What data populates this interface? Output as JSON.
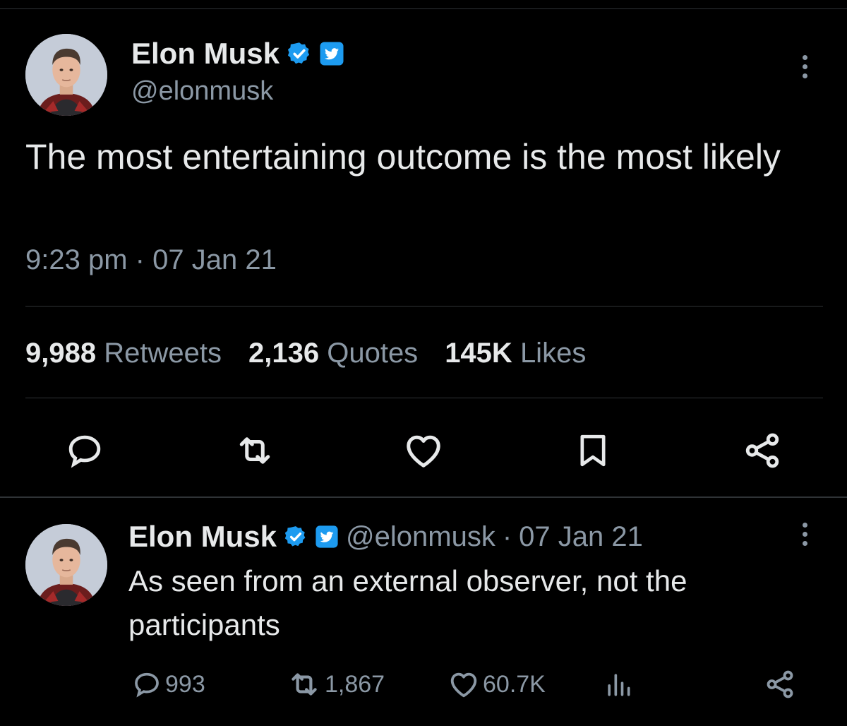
{
  "main_tweet": {
    "author_name": "Elon Musk",
    "handle": "@elonmusk",
    "text": "The most entertaining outcome is the most likely",
    "time": "9:23 pm",
    "date": "07 Jan 21",
    "stats": {
      "retweets_count": "9,988",
      "retweets_label": "Retweets",
      "quotes_count": "2,136",
      "quotes_label": "Quotes",
      "likes_count": "145K",
      "likes_label": "Likes"
    }
  },
  "reply_tweet": {
    "author_name": "Elon Musk",
    "handle": "@elonmusk",
    "date": "07 Jan 21",
    "text": "As seen from an external observer, not the participants",
    "replies": "993",
    "retweets": "1,867",
    "likes": "60.7K"
  },
  "separator": "·",
  "colors": {
    "background": "#000000",
    "text": "#e7e9ea",
    "secondary": "#8b98a5",
    "verified": "#1d9bf0",
    "divider": "#2f3336"
  },
  "icons": [
    "verified-badge-icon",
    "twitter-logo-badge-icon",
    "more-icon",
    "reply-icon",
    "retweet-icon",
    "like-icon",
    "bookmark-icon",
    "share-icon",
    "views-icon"
  ]
}
